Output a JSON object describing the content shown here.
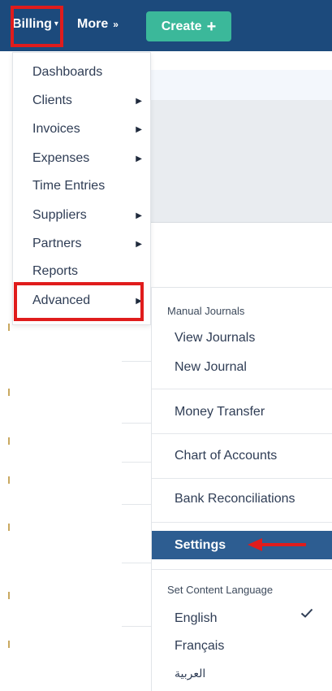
{
  "topbar": {
    "billing_label": "Billing",
    "more_label": "More",
    "create_label": "Create",
    "colors": {
      "background": "#1c4a7c",
      "create_button": "#3bb89a"
    }
  },
  "billing_menu": {
    "items": [
      {
        "label": "Dashboards",
        "has_submenu": false
      },
      {
        "label": "Clients",
        "has_submenu": true
      },
      {
        "label": "Invoices",
        "has_submenu": true
      },
      {
        "label": "Expenses",
        "has_submenu": true
      },
      {
        "label": "Time Entries",
        "has_submenu": false
      },
      {
        "label": "Suppliers",
        "has_submenu": true
      },
      {
        "label": "Partners",
        "has_submenu": true
      },
      {
        "label": "Reports",
        "has_submenu": false
      },
      {
        "label": "Advanced",
        "has_submenu": true
      }
    ]
  },
  "advanced_menu": {
    "manual_journals_header": "Manual Journals",
    "view_journals": "View Journals",
    "new_journal": "New Journal",
    "money_transfer": "Money Transfer",
    "chart_of_accounts": "Chart of Accounts",
    "bank_reconciliations": "Bank Reconciliations",
    "settings": "Settings",
    "language_header": "Set Content Language",
    "languages": [
      {
        "label": "English",
        "selected": true
      },
      {
        "label": "Français",
        "selected": false
      },
      {
        "label": "العربية",
        "selected": false
      }
    ],
    "colors": {
      "active_item": "#2d5d91"
    }
  },
  "annotations": {
    "color": "#e01c1c"
  }
}
